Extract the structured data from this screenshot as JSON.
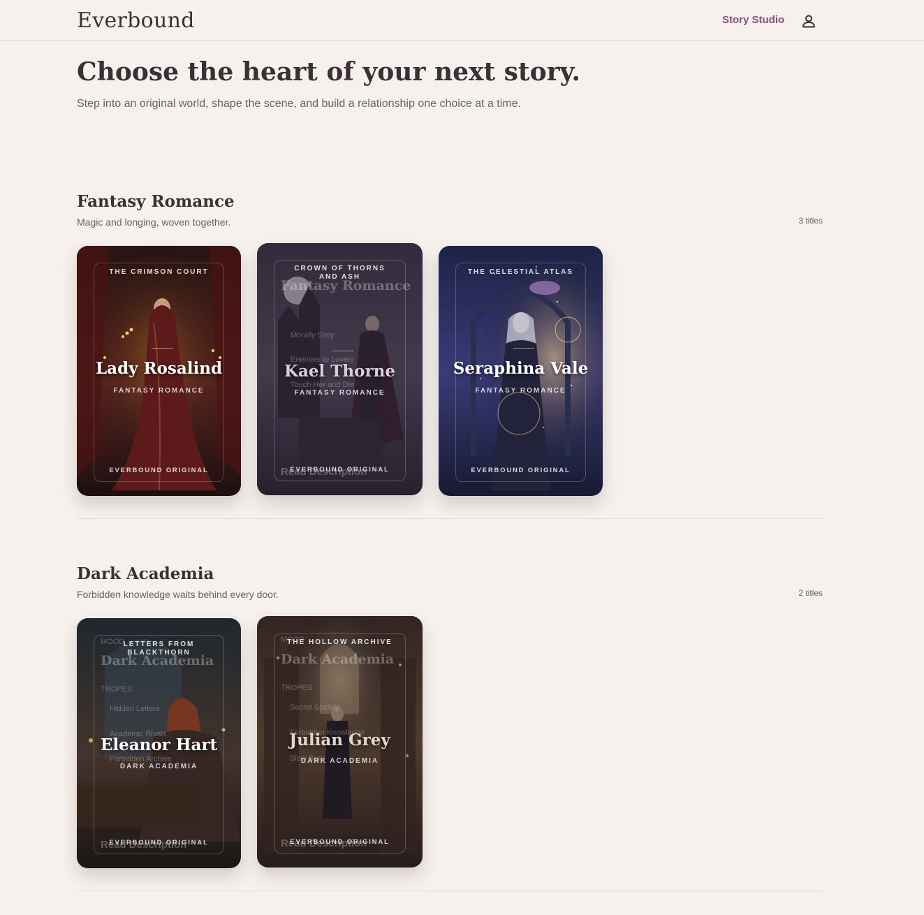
{
  "header": {
    "logo": "Everbound",
    "studio_link": "Story Studio",
    "account_icon": "user-icon"
  },
  "hero": {
    "title": "Choose the heart of your next story.",
    "subtitle": "Step into an original world, shape the scene, and build a relationship one choice at a time."
  },
  "sections": [
    {
      "title": "Fantasy Romance",
      "subtitle": "Magic and longing, woven together.",
      "count": "3 titles",
      "cards": [
        {
          "kicker": "THE CRIMSON COURT",
          "name": "Lady Rosalind",
          "genre": "FANTASY ROMANCE",
          "badge": "EVERBOUND ORIGINAL",
          "palette": [
            "#2a1414",
            "#5a2320",
            "#1d0f10"
          ]
        },
        {
          "kicker": "CROWN OF THORNS AND ASH",
          "name": "Kael Thorne",
          "genre": "FANTASY ROMANCE",
          "badge": "EVERBOUND ORIGINAL",
          "palette": [
            "#3a3446",
            "#514a60",
            "#2a2331"
          ],
          "ghost": {
            "genre_title": "Fantasy Romance",
            "trope_1": "Morally Grey",
            "trope_2": "Enemies to Lovers",
            "trope_3": "Touch Her and Die",
            "cta": "Read Description"
          }
        },
        {
          "kicker": "THE CELESTIAL ATLAS",
          "name": "Seraphina Vale",
          "genre": "FANTASY ROMANCE",
          "badge": "EVERBOUND ORIGINAL",
          "palette": [
            "#1c2346",
            "#3a3a78",
            "#171a30"
          ]
        }
      ]
    },
    {
      "title": "Dark Academia",
      "subtitle": "Forbidden knowledge waits behind every door.",
      "count": "2 titles",
      "cards": [
        {
          "kicker": "LETTERS FROM BLACKTHORN",
          "name": "Eleanor Hart",
          "genre": "DARK ACADEMIA",
          "badge": "EVERBOUND ORIGINAL",
          "palette": [
            "#1e2a30",
            "#4a3a2c",
            "#1a1512"
          ],
          "ghost": {
            "mood": "MOOD",
            "genre_title": "Dark Academia",
            "tropes": "TROPES",
            "trope_1": "Hidden Letters",
            "trope_2": "Academic Rivals",
            "trope_3": "Forbidden Archive",
            "cta": "Read Description"
          }
        },
        {
          "kicker": "THE HOLLOW ARCHIVE",
          "name": "Julian Grey",
          "genre": "DARK ACADEMIA",
          "badge": "EVERBOUND ORIGINAL",
          "palette": [
            "#3a2a1c",
            "#6a4a2a",
            "#2a1c12"
          ],
          "ghost": {
            "mood": "MOOD",
            "genre_title": "Dark Academia",
            "tropes": "TROPES",
            "trope_1": "Secret Society",
            "trope_2": "Forbidden Knowledge",
            "trope_3": "Slow Burn",
            "cta": "Read Description"
          }
        }
      ]
    }
  ],
  "colors": {
    "background": "#f6f1ec",
    "accent": "#8e4c74",
    "heading": "#3a3036"
  }
}
